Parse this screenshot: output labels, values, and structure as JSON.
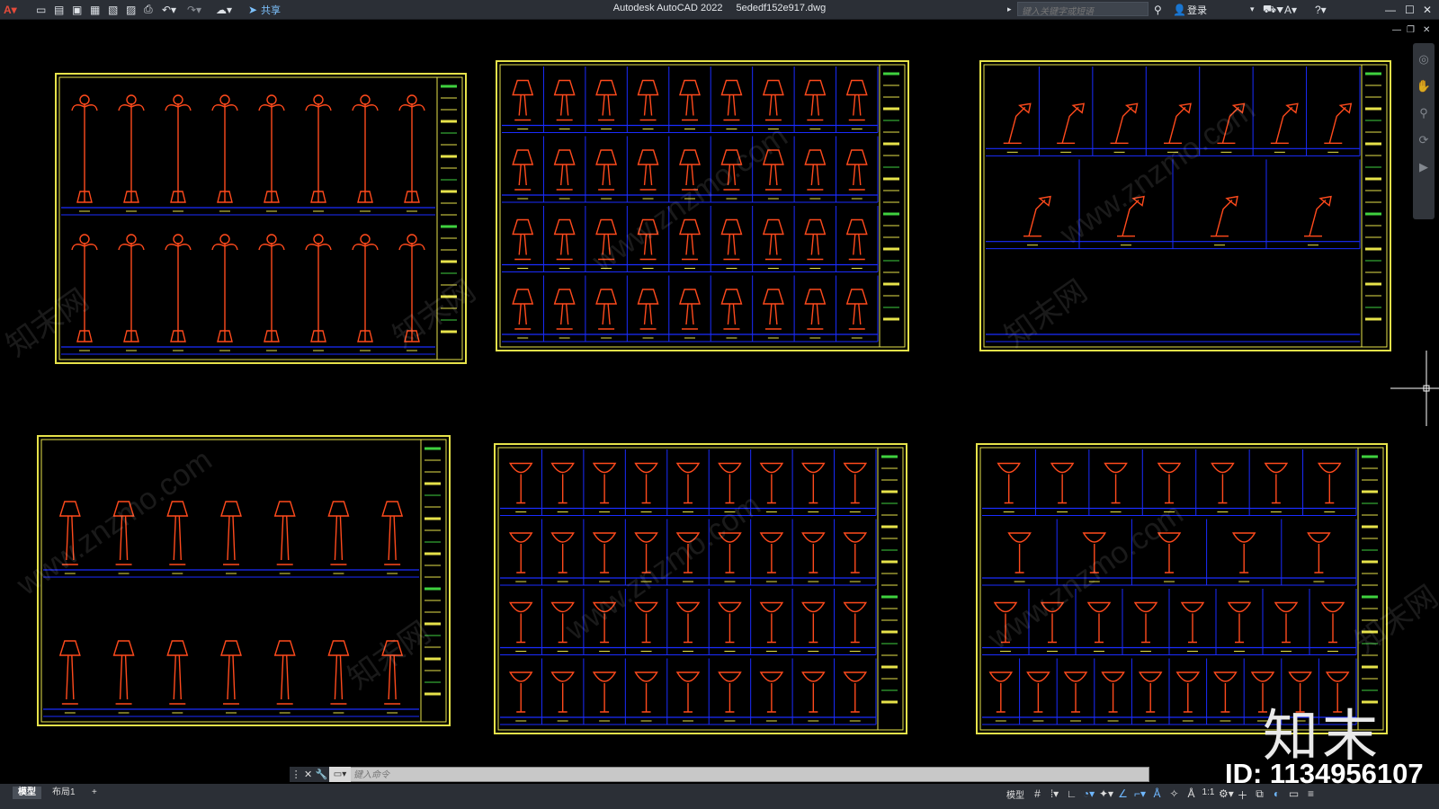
{
  "app": {
    "title": "Autodesk AutoCAD 2022",
    "filename": "5ededf152e917.dwg"
  },
  "toolbar": {
    "share_label": "共享",
    "search_placeholder": "键入关键字或短语",
    "login_label": "登录"
  },
  "command": {
    "placeholder": "键入命令"
  },
  "layout_tabs": [
    {
      "label": "模型",
      "active": true
    },
    {
      "label": "布局1",
      "active": false
    },
    {
      "label": "+",
      "active": false
    }
  ],
  "status": {
    "model_label": "模型",
    "scale_label": "1:1"
  },
  "watermark": {
    "brand_cn": "知末",
    "id_text": "ID: 1134956107",
    "site_text": "www.znzmo.com",
    "cn_text": "知末网"
  },
  "colors": {
    "frame": "#e6e24a",
    "grid": "#1a2cff",
    "lamp": "#ff4a1c",
    "titleblock_text": "#e6e24a",
    "titleblock_green": "#3fd13f",
    "background": "#000000"
  },
  "sheets": [
    {
      "name": "street-lamps",
      "rows": [
        8,
        8
      ]
    },
    {
      "name": "table-lamps",
      "rows": [
        9,
        9,
        9,
        9
      ]
    },
    {
      "name": "desk-lamps",
      "rows": [
        7,
        4,
        0
      ]
    },
    {
      "name": "floor-and-garden-lamps",
      "rows": [
        7,
        7
      ]
    },
    {
      "name": "wall-sconces-a",
      "rows": [
        9,
        9,
        9,
        9
      ]
    },
    {
      "name": "wall-sconces-b",
      "rows": [
        7,
        5,
        8,
        10
      ]
    }
  ]
}
